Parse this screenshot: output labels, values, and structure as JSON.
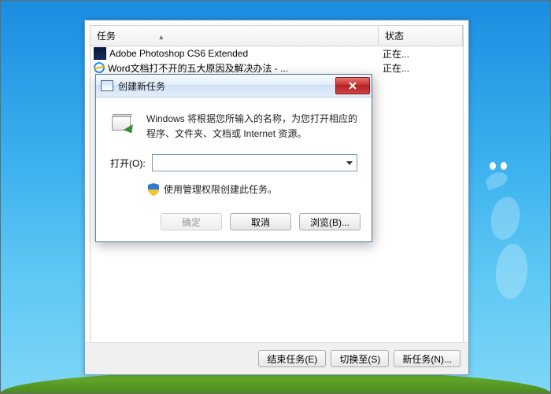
{
  "task_manager": {
    "columns": {
      "task": "任务",
      "status": "状态"
    },
    "rows": [
      {
        "icon": "photoshop-icon",
        "name": "Adobe Photoshop CS6 Extended",
        "status": "正在..."
      },
      {
        "icon": "ie-icon",
        "name": "Word文档打不开的五大原因及解决办法 - ...",
        "status": "正在..."
      }
    ],
    "buttons": {
      "end_task": "结束任务(E)",
      "switch_to": "切换至(S)",
      "new_task": "新任务(N)..."
    }
  },
  "run_dialog": {
    "title": "创建新任务",
    "message": "Windows 将根据您所输入的名称，为您打开相应的程序、文件夹、文档或 Internet 资源。",
    "open_label": "打开(O):",
    "input_value": "",
    "admin_note": "使用管理权限创建此任务。",
    "buttons": {
      "ok": "确定",
      "cancel": "取消",
      "browse": "浏览(B)..."
    }
  }
}
